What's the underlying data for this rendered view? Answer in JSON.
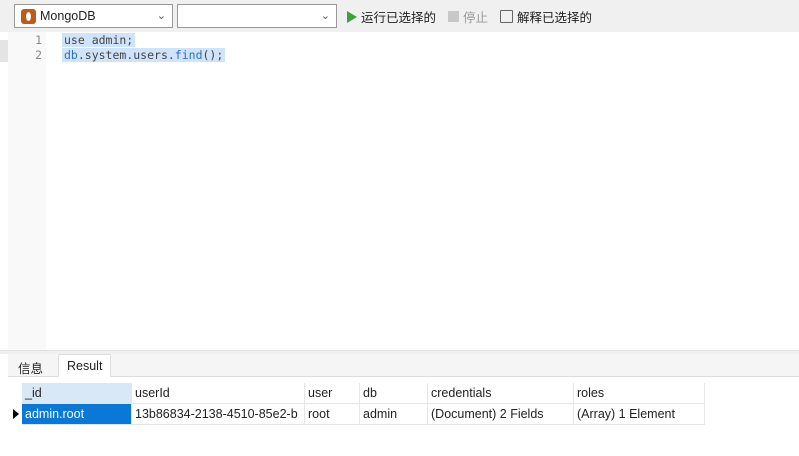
{
  "toolbar": {
    "connection": "MongoDB",
    "database": "",
    "run_selected": "运行已选择的",
    "stop": "停止",
    "explain_selected": "解释已选择的"
  },
  "editor": {
    "line_numbers": [
      "1",
      "2"
    ],
    "lines": [
      {
        "text": "use admin;"
      },
      {
        "prefix": "db",
        "rest": ".system.users.",
        "fn": "find",
        "end": "();"
      }
    ]
  },
  "tabs": [
    "信息",
    "Result"
  ],
  "active_tab": "Result",
  "grid": {
    "columns": [
      "_id",
      "userId",
      "user",
      "db",
      "credentials",
      "roles"
    ],
    "rows": [
      [
        "admin.root",
        "13b86834-2138-4510-85e2-b",
        "root",
        "admin",
        "(Document) 2 Fields",
        "(Array) 1 Element"
      ]
    ]
  }
}
